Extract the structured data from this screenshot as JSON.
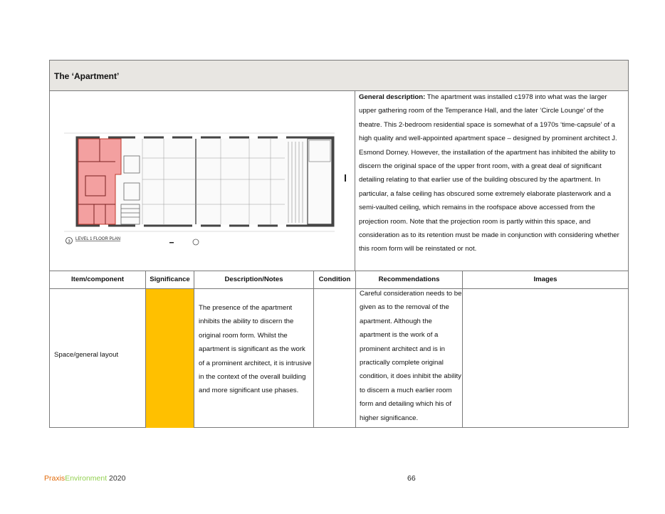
{
  "section": {
    "title": "The ‘Apartment’"
  },
  "plan": {
    "label_number": "3",
    "label_title": "LEVEL 1 FLOOR PLAN",
    "highlight_color": "#f3a0a0"
  },
  "description": {
    "lead": "General description:",
    "text": " The apartment was installed c1978 into what was the larger upper gathering room of the Temperance Hall, and the later ‘Circle Lounge’ of the theatre. This 2-bedroom residential space is somewhat of a 1970s ‘time-capsule’ of a high quality and well-appointed apartment space – designed by prominent architect J. Esmond Dorney.  However, the installation of the apartment has inhibited the ability to discern the original space of the upper front room, with a great deal of significant detailing relating to that earlier use of the building obscured by the apartment. In particular, a false ceiling has obscured some extremely elaborate plasterwork and a semi-vaulted ceiling, which remains in the roofspace above accessed from the projection room.  Note that the projection room is partly within this space, and consideration as to its retention must be made in conjunction with considering whether this room form will be reinstated or not."
  },
  "table": {
    "headers": [
      "Item/component",
      "Significance",
      "Description/Notes",
      "Condition",
      "Recommendations",
      "Images"
    ],
    "row": {
      "item": "Space/general layout",
      "significance_color": "#ffc000",
      "notes": "The presence of the apartment inhibits the ability to discern the original room form.  Whilst the apartment is significant as the work of a prominent architect, it is intrusive in the context of the overall building and more significant use phases.",
      "condition": "",
      "recommendations": "Careful consideration needs to be given as to the removal of the apartment.  Although the apartment is the work of a prominent architect and is in practically complete original condition, it does inhibit the ability to discern a much earlier room form and detailing which his of higher significance.",
      "images": ""
    }
  },
  "footer": {
    "brand_part1": "Praxis",
    "brand_part2": "Environment",
    "year": " 2020",
    "page": "66"
  }
}
